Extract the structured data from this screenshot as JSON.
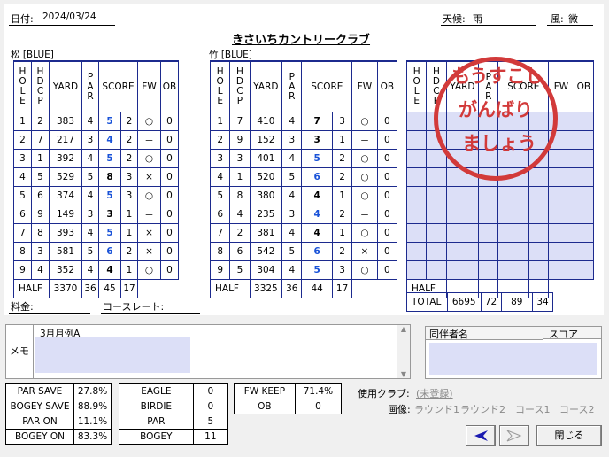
{
  "header": {
    "date_label": "日付:",
    "date": "2024/03/24",
    "weather_label": "天候:",
    "weather": "雨",
    "wind_label": "風:",
    "wind": "微",
    "course_name": "きさいちカントリークラブ"
  },
  "out": {
    "label": "松 [BLUE]",
    "columns": [
      "HOLE",
      "HDCP",
      "YARD",
      "PAR",
      "SCORE",
      "FW",
      "OB"
    ],
    "rows": [
      {
        "hole": "1",
        "hdcp": "2",
        "yard": "383",
        "par": "4",
        "score": "5",
        "putts": "2",
        "fw": "○",
        "ob": "0"
      },
      {
        "hole": "2",
        "hdcp": "7",
        "yard": "217",
        "par": "3",
        "score": "4",
        "putts": "2",
        "fw": "－",
        "ob": "0"
      },
      {
        "hole": "3",
        "hdcp": "1",
        "yard": "392",
        "par": "4",
        "score": "5",
        "putts": "2",
        "fw": "○",
        "ob": "0"
      },
      {
        "hole": "4",
        "hdcp": "5",
        "yard": "529",
        "par": "5",
        "score": "8",
        "putts": "3",
        "fw": "×",
        "ob": "0"
      },
      {
        "hole": "5",
        "hdcp": "6",
        "yard": "374",
        "par": "4",
        "score": "5",
        "putts": "3",
        "fw": "○",
        "ob": "0"
      },
      {
        "hole": "6",
        "hdcp": "9",
        "yard": "149",
        "par": "3",
        "score": "3",
        "putts": "1",
        "fw": "－",
        "ob": "0"
      },
      {
        "hole": "7",
        "hdcp": "8",
        "yard": "393",
        "par": "4",
        "score": "5",
        "putts": "1",
        "fw": "×",
        "ob": "0"
      },
      {
        "hole": "8",
        "hdcp": "3",
        "yard": "581",
        "par": "5",
        "score": "6",
        "putts": "2",
        "fw": "×",
        "ob": "0"
      },
      {
        "hole": "9",
        "hdcp": "4",
        "yard": "352",
        "par": "4",
        "score": "4",
        "putts": "1",
        "fw": "○",
        "ob": "0"
      }
    ],
    "half": {
      "label": "HALF",
      "yard": "3370",
      "par": "36",
      "score": "45",
      "putts": "17"
    }
  },
  "in": {
    "label": "竹 [BLUE]",
    "rows": [
      {
        "hole": "1",
        "hdcp": "7",
        "yard": "410",
        "par": "4",
        "score": "7",
        "putts": "3",
        "fw": "○",
        "ob": "0"
      },
      {
        "hole": "2",
        "hdcp": "9",
        "yard": "152",
        "par": "3",
        "score": "3",
        "putts": "1",
        "fw": "－",
        "ob": "0"
      },
      {
        "hole": "3",
        "hdcp": "3",
        "yard": "401",
        "par": "4",
        "score": "5",
        "putts": "2",
        "fw": "○",
        "ob": "0"
      },
      {
        "hole": "4",
        "hdcp": "1",
        "yard": "520",
        "par": "5",
        "score": "6",
        "putts": "2",
        "fw": "○",
        "ob": "0"
      },
      {
        "hole": "5",
        "hdcp": "8",
        "yard": "380",
        "par": "4",
        "score": "4",
        "putts": "1",
        "fw": "○",
        "ob": "0"
      },
      {
        "hole": "6",
        "hdcp": "4",
        "yard": "235",
        "par": "3",
        "score": "4",
        "putts": "2",
        "fw": "－",
        "ob": "0"
      },
      {
        "hole": "7",
        "hdcp": "2",
        "yard": "381",
        "par": "4",
        "score": "4",
        "putts": "1",
        "fw": "○",
        "ob": "0"
      },
      {
        "hole": "8",
        "hdcp": "6",
        "yard": "542",
        "par": "5",
        "score": "6",
        "putts": "2",
        "fw": "×",
        "ob": "0"
      },
      {
        "hole": "9",
        "hdcp": "5",
        "yard": "304",
        "par": "4",
        "score": "5",
        "putts": "3",
        "fw": "○",
        "ob": "0"
      }
    ],
    "half": {
      "label": "HALF",
      "yard": "3325",
      "par": "36",
      "score": "44",
      "putts": "17"
    }
  },
  "third": {
    "half_label": "HALF"
  },
  "total": {
    "label": "TOTAL",
    "yard": "6695",
    "par": "72",
    "score": "89",
    "putts": "34"
  },
  "stamp": {
    "lines": [
      "もうすこし",
      "がんばり",
      "ましょう"
    ],
    "color": "#d23a3a"
  },
  "fee_label": "料金:",
  "course_rate_label": "コースレート:",
  "memo": {
    "label": "メモ",
    "text": "3月月例A"
  },
  "companion": {
    "col_name": "同伴者名",
    "col_score": "スコア"
  },
  "stats1": [
    {
      "label": "PAR SAVE",
      "value": "27.8%"
    },
    {
      "label": "BOGEY SAVE",
      "value": "88.9%"
    },
    {
      "label": "PAR ON",
      "value": "11.1%"
    },
    {
      "label": "BOGEY ON",
      "value": "83.3%"
    }
  ],
  "stats2": [
    {
      "label": "EAGLE",
      "value": "0"
    },
    {
      "label": "BIRDIE",
      "value": "0"
    },
    {
      "label": "PAR",
      "value": "5"
    },
    {
      "label": "BOGEY",
      "value": "11"
    }
  ],
  "stats3": [
    {
      "label": "FW KEEP",
      "value": "71.4%"
    },
    {
      "label": "OB",
      "value": "0"
    }
  ],
  "club": {
    "label": "使用クラブ:",
    "value": "(未登録)"
  },
  "image": {
    "label": "画像:",
    "links": [
      "ラウンド1",
      "ラウンド2",
      "コース1",
      "コース2"
    ]
  },
  "buttons": {
    "close": "閉じる"
  },
  "colors": {
    "grid": "#1c2a8e",
    "score_blue": "#1a53d8",
    "blank": "#dcdff7"
  }
}
